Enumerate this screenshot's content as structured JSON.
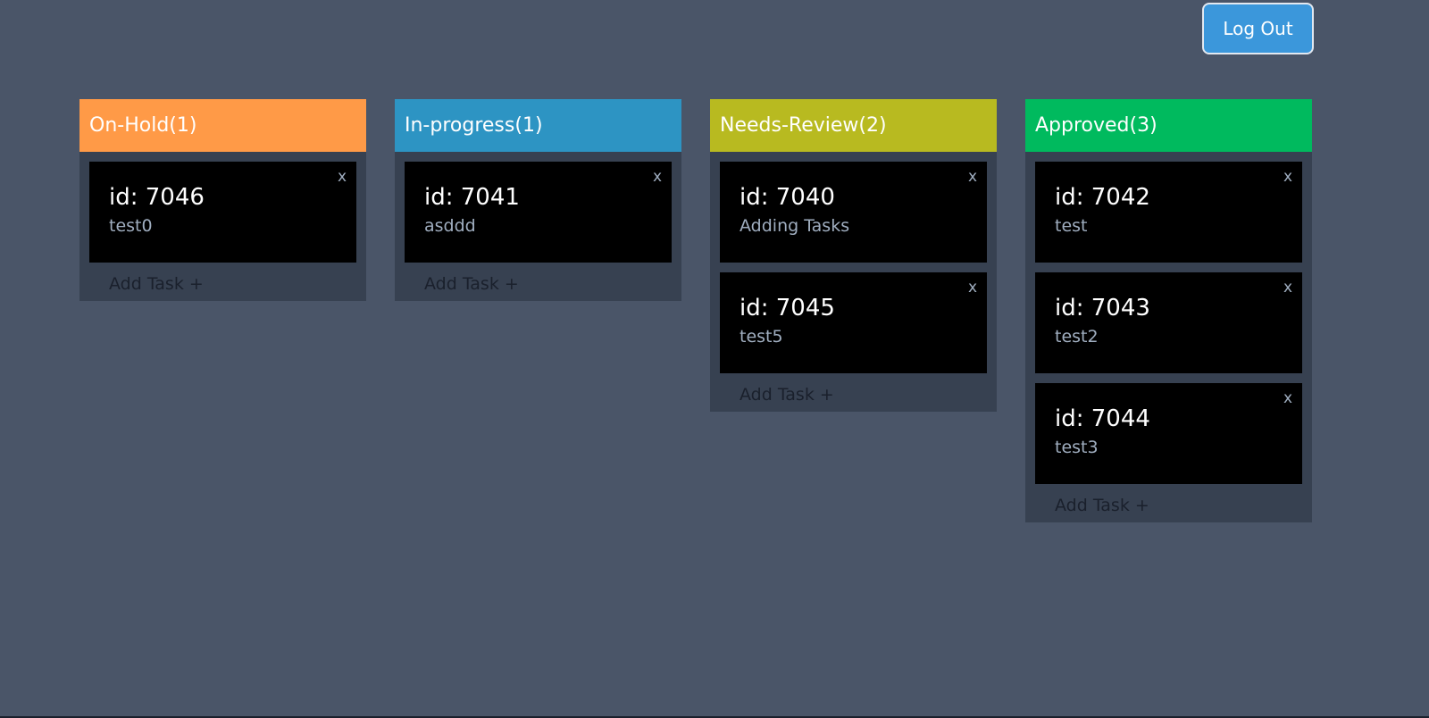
{
  "header": {
    "logout_label": "Log Out"
  },
  "colors": {
    "background": "#4a5568",
    "column_body": "#374151",
    "card": "#000000",
    "logout_button": "#3b97db"
  },
  "columns": [
    {
      "title": "On-Hold",
      "count": "1",
      "color": "#ff9a47",
      "add_label": "Add Task +",
      "tasks": [
        {
          "id": "id: 7046",
          "desc": "test0",
          "close": "x"
        }
      ]
    },
    {
      "title": "In-progress",
      "count": "1",
      "color": "#2d94c3",
      "add_label": "Add Task +",
      "tasks": [
        {
          "id": "id: 7041",
          "desc": "asddd",
          "close": "x"
        }
      ]
    },
    {
      "title": "Needs-Review",
      "count": "2",
      "color": "#b8ba20",
      "add_label": "Add Task +",
      "tasks": [
        {
          "id": "id: 7040",
          "desc": "Adding Tasks",
          "close": "x"
        },
        {
          "id": "id: 7045",
          "desc": "test5",
          "close": "x"
        }
      ]
    },
    {
      "title": "Approved",
      "count": "3",
      "color": "#00ba5e",
      "add_label": "Add Task +",
      "tasks": [
        {
          "id": "id: 7042",
          "desc": "test",
          "close": "x"
        },
        {
          "id": "id: 7043",
          "desc": "test2",
          "close": "x"
        },
        {
          "id": "id: 7044",
          "desc": "test3",
          "close": "x"
        }
      ]
    }
  ]
}
